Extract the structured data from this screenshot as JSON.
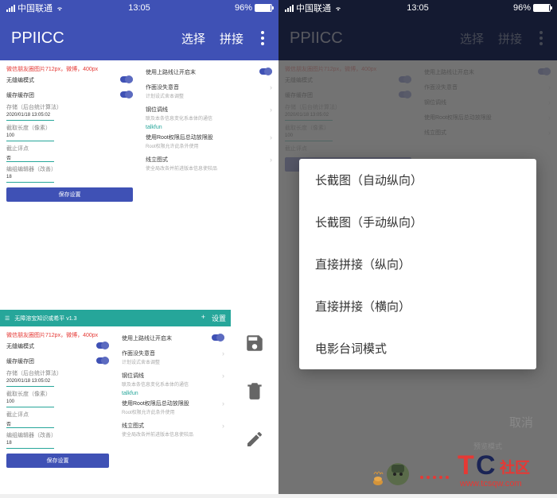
{
  "status": {
    "carrier": "中国联通",
    "time": "13:05",
    "battery": "96%"
  },
  "app": {
    "title": "PPIICC",
    "action_select": "选择",
    "action_stitch": "拼接"
  },
  "settings_left": {
    "header_red": "微信朋友圈图片712px，微博，400px",
    "row1": "无缝编模式",
    "row2": "缓存缓存团",
    "row3_label": "存储（后台统计算法）",
    "row3_value": "2020/01/18 13:05:02",
    "row4_label": "截取长度（像素）",
    "row4_value": "100",
    "row5_label": "截止评点",
    "row5_value": "否",
    "row6_label": "编组编辑器（改善）",
    "row6_value": "18",
    "button": "保存设置"
  },
  "settings_right": {
    "row1_title": "使用上路线让开启末",
    "row2_title": "作面没失意音",
    "row2_sub": "计划设式舍本调整",
    "row3_title": "钢位调线",
    "row3_sub": "联及本条信息变化系本体的通信",
    "row4_teal": "talkfun",
    "row4_title": "使用Root权限后总动放限股",
    "row4_sub": "Root权限允许此条外使用",
    "row5_title": "线立图式",
    "row5_sub": "使全局改各并前进版本信息使较品"
  },
  "stitched": {
    "bar_title": "无障溶宝知识或希平 v1.3",
    "bar_plus": "+",
    "bar_settings": "设置"
  },
  "dialog": {
    "items": [
      "长截图（自动纵向）",
      "长截图（手动纵向）",
      "直接拼接（纵向）",
      "直接拼接（横向）",
      "电影台词模式"
    ],
    "cancel": "取消"
  },
  "logo": {
    "preview": "预览模式",
    "tc": "TC",
    "community": "社区",
    "url": "www.tcsqw.com"
  }
}
